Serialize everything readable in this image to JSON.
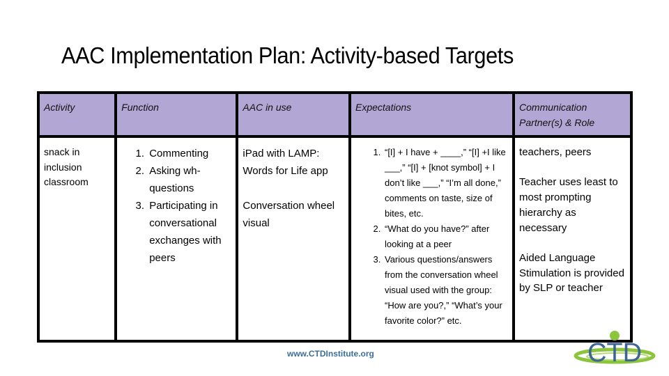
{
  "title": "AAC Implementation Plan: Activity-based Targets",
  "table": {
    "headers": [
      "Activity",
      "Function",
      "AAC in use",
      "Expectations",
      "Communication Partner(s) & Role"
    ],
    "rows": [
      {
        "activity": "snack in inclusion classroom",
        "function": [
          "Commenting",
          "Asking wh-questions",
          "Participating in conversational exchanges with peers"
        ],
        "aac_in_use": [
          "iPad with LAMP: Words for Life app",
          "Conversation wheel visual"
        ],
        "expectations": [
          "“[I] + I  have + ____,” “[I] +I like ___,” “[I] + [knot symbol] + I don’t like ___,” “I’m all done,” comments on taste, size of bites, etc.",
          "“What do you have?” after looking at a peer",
          "Various questions/answers from the conversation wheel visual used with the group: “How are you?,” “What’s your favorite color?” etc."
        ],
        "partners": [
          "teachers, peers",
          "Teacher uses least to most prompting hierarchy as necessary",
          "Aided Language Stimulation is provided by SLP or teacher"
        ]
      }
    ]
  },
  "header_color": "#b2a6d5",
  "footer": {
    "url": "www.CTDInstitute.org"
  },
  "logo": {
    "text": "CTD",
    "icon": "ctd-logo-icon",
    "text_color": "#3c6496",
    "accent_color": "#8cc43c"
  }
}
